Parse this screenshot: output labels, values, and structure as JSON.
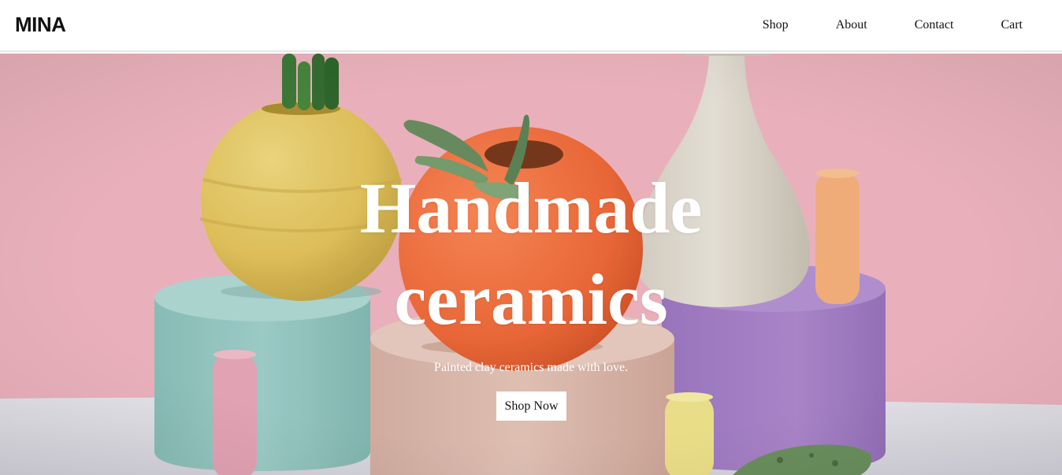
{
  "header": {
    "logo": "MINA",
    "nav": [
      {
        "label": "Shop"
      },
      {
        "label": "About"
      },
      {
        "label": "Contact"
      },
      {
        "label": "Cart"
      }
    ]
  },
  "hero": {
    "title_line1": "Handmade",
    "title_line2": "ceramics",
    "subtitle": "Painted clay ceramics made with love.",
    "cta_label": "Shop Now"
  },
  "colors": {
    "hero_background": "#f3b8c3",
    "accent_button": "#ffffff",
    "text_dark": "#111111"
  }
}
